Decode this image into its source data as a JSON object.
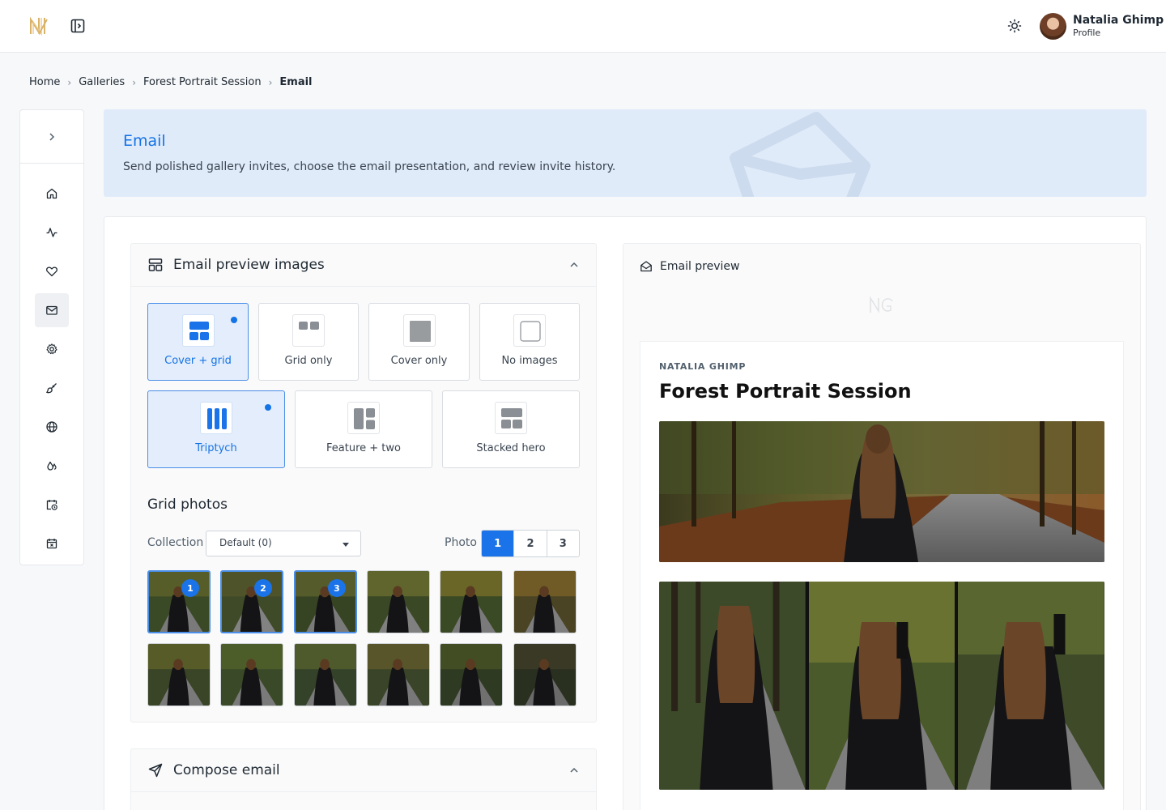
{
  "header": {
    "profile_name": "Natalia Ghimp",
    "profile_sub": "Profile"
  },
  "breadcrumb": [
    "Home",
    "Galleries",
    "Forest Portrait Session",
    "Email"
  ],
  "rail": {
    "items": [
      "home-icon",
      "activity-icon",
      "heart-icon",
      "mail-icon",
      "gear-icon",
      "brush-icon",
      "globe-icon",
      "droplets-icon",
      "calendar-clock-icon",
      "calendar-x-icon"
    ],
    "active": "mail-icon"
  },
  "hero": {
    "title": "Email",
    "description": "Send polished gallery invites, choose the email presentation, and review invite history."
  },
  "images_panel": {
    "title": "Email preview images",
    "layouts": [
      {
        "label": "Cover + grid",
        "selected": true
      },
      {
        "label": "Grid only",
        "selected": false
      },
      {
        "label": "Cover only",
        "selected": false
      },
      {
        "label": "No images",
        "selected": false
      }
    ],
    "grid_styles": [
      {
        "label": "Triptych",
        "selected": true
      },
      {
        "label": "Feature + two",
        "selected": false
      },
      {
        "label": "Stacked hero",
        "selected": false
      }
    ],
    "grid_photos_title": "Grid photos",
    "collection_label": "Collection",
    "collection_value": "Default (0)",
    "photo_label": "Photo",
    "photo_slots": [
      "1",
      "2",
      "3"
    ],
    "photo_slot_active": "1",
    "thumbnail_badges": [
      "1",
      "2",
      "3"
    ]
  },
  "compose_panel": {
    "title": "Compose email"
  },
  "preview": {
    "header": "Email preview",
    "eyebrow": "NATALIA GHIMP",
    "title": "Forest Portrait Session"
  },
  "colors": {
    "accent": "#1a73e8",
    "hero_bg": "#e0ebfa",
    "selected_bg": "#e3edfb"
  }
}
